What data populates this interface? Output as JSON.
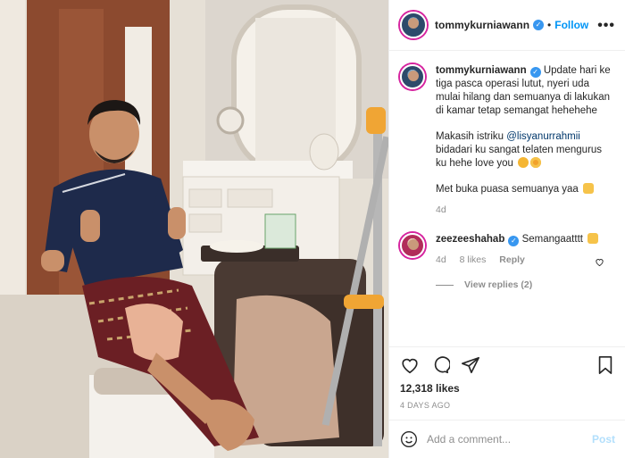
{
  "post": {
    "author": "tommykurniawann",
    "follow_label": "Follow",
    "dot": "•",
    "more_label": "•••"
  },
  "caption": {
    "username": "tommykurniawann",
    "line1": "Update hari ke tiga pasca operasi lutut, nyeri uda mulai hilang dan semuanya di lakukan di kamar tetap semangat hehehehe",
    "line2_prefix": "Makasih istriku ",
    "mention": "@lisyanurrahmii",
    "line2_suffix": " bidadari ku sangat telaten mengurus ku hehe love you",
    "line3": "Met buka puasa semuanya yaa",
    "age": "4d"
  },
  "comment": {
    "username": "zeezeeshahab",
    "text": "Semangaatttt",
    "age": "4d",
    "likes": "8 likes",
    "reply_label": "Reply",
    "view_replies": "View replies (2)"
  },
  "stats": {
    "likes": "12,318 likes",
    "date": "4 DAYS AGO"
  },
  "comment_input": {
    "placeholder": "Add a comment...",
    "post_label": "Post"
  },
  "icons": {
    "header": [
      "verified-icon",
      "more-options-icon"
    ],
    "actions": [
      "heart-icon",
      "comment-icon",
      "share-icon",
      "bookmark-icon"
    ],
    "input": [
      "emoji-icon"
    ]
  },
  "colors": {
    "accent": "#0095f6",
    "verified": "#3897f0",
    "post_disabled": "#b2dffc",
    "muted": "#8e8e8e"
  }
}
